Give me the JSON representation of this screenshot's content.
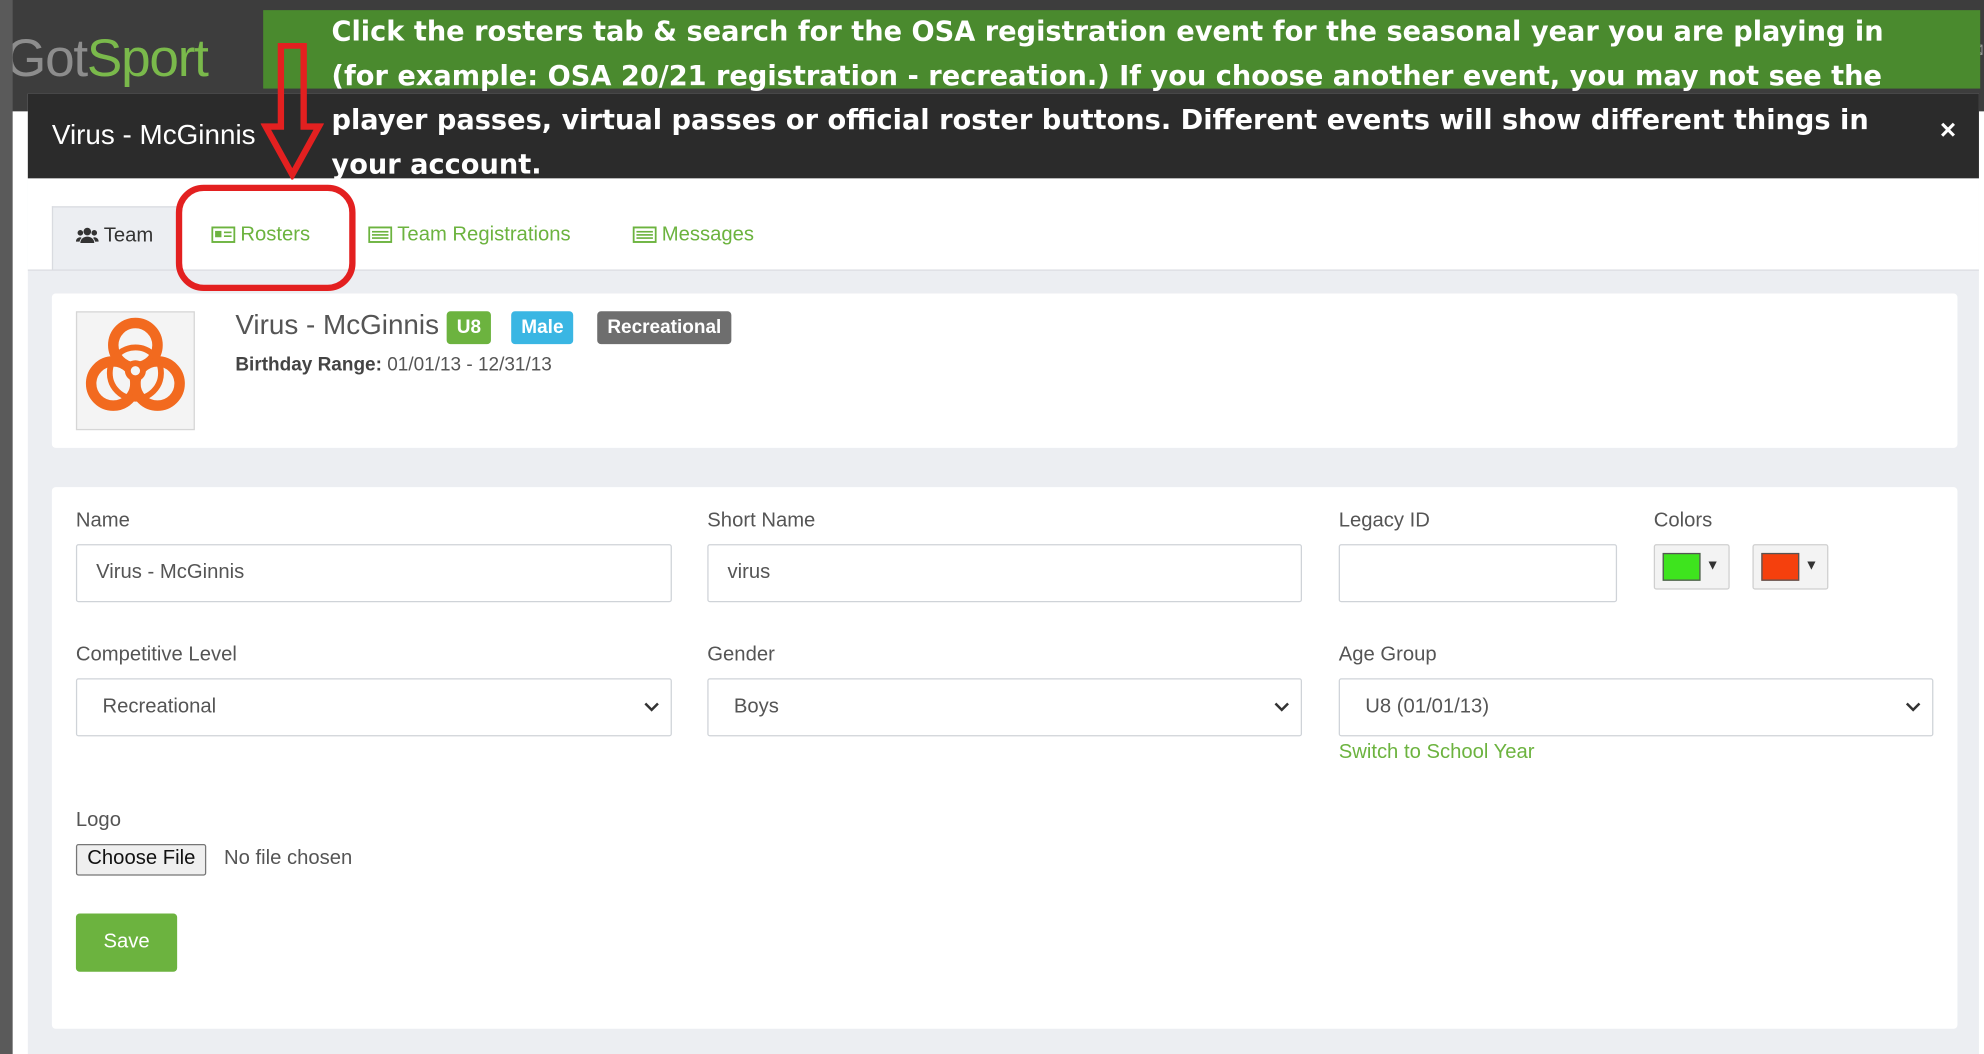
{
  "app": {
    "logo_got": "Got",
    "logo_sport": "Sport"
  },
  "modal": {
    "title": "Virus - McGinnis",
    "close_label": "×"
  },
  "tabs": [
    {
      "label": "Team",
      "icon": "users-icon",
      "active": true
    },
    {
      "label": "Rosters",
      "icon": "id-card-icon",
      "active": false
    },
    {
      "label": "Team Registrations",
      "icon": "list-icon",
      "active": false
    },
    {
      "label": "Messages",
      "icon": "list-icon",
      "active": false
    }
  ],
  "team_card": {
    "logo_icon": "biohazard-icon",
    "name": "Virus - McGinnis",
    "badges": [
      {
        "label": "U8",
        "color": "#6cb33f"
      },
      {
        "label": "Male",
        "color": "#3ab6e3"
      },
      {
        "label": "Recreational",
        "color": "#6e6e6e"
      }
    ],
    "birthday_label": "Birthday Range:",
    "birthday_value": "01/01/13 - 12/31/13"
  },
  "form": {
    "name_label": "Name",
    "name_value": "Virus - McGinnis",
    "short_name_label": "Short Name",
    "short_name_value": "virus",
    "legacy_id_label": "Legacy ID",
    "legacy_id_value": "",
    "colors_label": "Colors",
    "colors": [
      {
        "name": "primary",
        "value": "#3ee41e"
      },
      {
        "name": "secondary",
        "value": "#f5400d"
      }
    ],
    "color_arrow": "▼",
    "competitive_level_label": "Competitive Level",
    "competitive_level_value": "Recreational",
    "gender_label": "Gender",
    "gender_value": "Boys",
    "age_group_label": "Age Group",
    "age_group_value": "U8 (01/01/13)",
    "switch_link": "Switch to School Year",
    "logo_label": "Logo",
    "choose_file": "Choose File",
    "no_file": "No file chosen",
    "save": "Save"
  },
  "overlay": {
    "instruction_lines": [
      "Click the rosters tab & search for the OSA registration event for the seasonal year you are playing in",
      "(for example: OSA 20/21 registration - recreation.)  If you choose another event, you may not see the",
      "player passes, virtual passes or official roster buttons.  Different events will show different things in",
      "your account."
    ],
    "colors": {
      "arrow": "#e32020",
      "circle": "#e32020",
      "banner": "#4a8a2e"
    }
  }
}
